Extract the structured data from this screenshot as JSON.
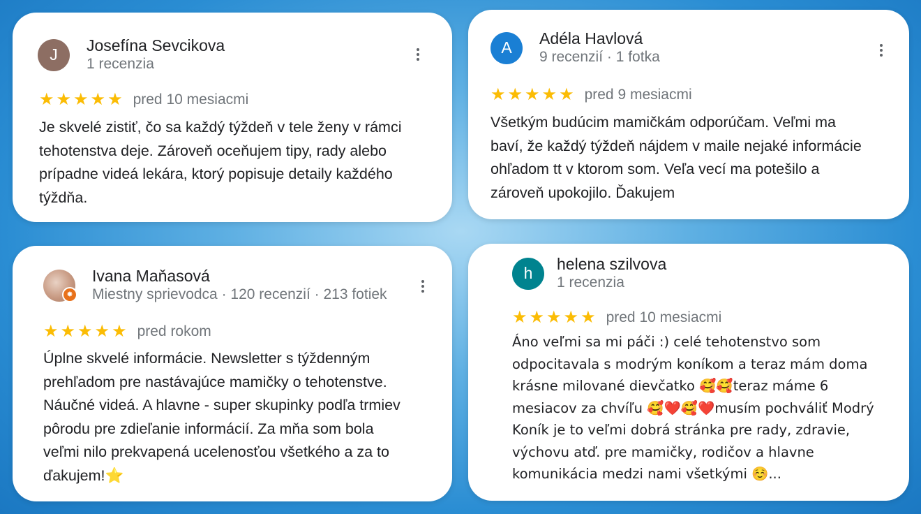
{
  "reviews": [
    {
      "initial": "J",
      "avatar_color": "#8d6e63",
      "name": "Josefína Sevcikova",
      "meta": "1 recenzia",
      "stars": "★★★★★",
      "when": "pred 10 mesiacmi",
      "text": "Je skvelé zistiť, čo sa každý týždeň v tele ženy v rámci\ntehotenstva deje. Zároveň oceňujem tipy, rady alebo\nprípadne videá lekára, ktorý popisuje detaily každého\ntýždňa."
    },
    {
      "initial": "A",
      "avatar_color": "#1a7fd4",
      "name": "Adéla Havlová",
      "meta": "9 recenzií · 1 fotka",
      "stars": "★★★★★",
      "when": "pred 9 mesiacmi",
      "text": "Všetkým budúcim mamičkám odporúčam. Veľmi ma\nbaví, že každý týždeň nájdem v maile nejaké informácie\nohľadom tt v ktorom som. Veľa vecí ma potešilo a\nzároveň upokojilo. Ďakujem"
    },
    {
      "name": "Ivana Maňasová",
      "meta": "Miestny sprievodca · 120 recenzií · 213 fotiek",
      "avatar_color": "#c9a48f",
      "stars": "★★★★★",
      "when": "pred rokom",
      "text": "Úplne skvelé informácie. Newsletter s týždenným\nprehľadom pre nastávajúce mamičky o tehotenstve.\nNáučné videá. A hlavne - super skupinky podľa trmiev\npôrodu pre zdieľanie informácií. Za mňa som bola\nveľmi nilo prekvapená ucelenosťou všetkého a za to\nďakujem!⭐"
    },
    {
      "initial": "h",
      "avatar_color": "#00838f",
      "name": "helena szilvova",
      "meta": "1 recenzia",
      "stars": "★★★★★",
      "when": "pred 10 mesiacmi",
      "text": "Áno veľmi sa mi páči :) celé tehotenstvo som\nodpocitavala s modrým koníkom a teraz mám doma\nkrásne milované dievčatko 🥰🥰teraz máme 6\nmesiacov za chvíľu 🥰❤️🥰❤️musím pochváliť Modrý\nKoník je to veľmi dobrá stránka pre rady, zdravie,\nvýchovu atď. pre mamičky, rodičov a hlavne\nkomunikácia medzi nami všetkými ☺️..."
    }
  ]
}
